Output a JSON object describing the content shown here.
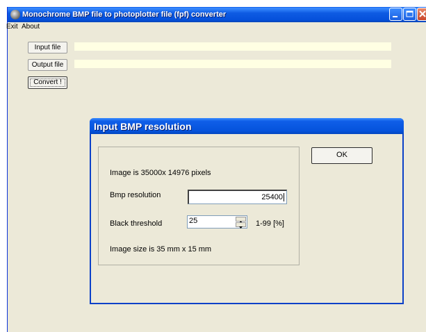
{
  "window": {
    "title": "Monochrome BMP file to photoplotter file (fpf) converter"
  },
  "menu": {
    "exit": "Exit",
    "about": "About"
  },
  "main": {
    "input_file_label": "Input file",
    "output_file_label": "Output file",
    "convert_label": "Convert !",
    "input_path": "",
    "output_path": ""
  },
  "dialog": {
    "title": "Input BMP resolution",
    "image_pixels_text": "Image is 35000x 14976 pixels",
    "bmp_resolution_label": "Bmp resolution",
    "bmp_resolution_value": "25400",
    "black_threshold_label": "Black threshold",
    "black_threshold_value": "25",
    "threshold_range_text": "1-99 [%]",
    "image_size_text": "Image size is 35 mm  x  15 mm",
    "ok_label": "OK"
  },
  "colors": {
    "titlebar_blue": "#0553DC",
    "window_face": "#ECE9D8",
    "path_field_bg": "#FFFFE3"
  }
}
